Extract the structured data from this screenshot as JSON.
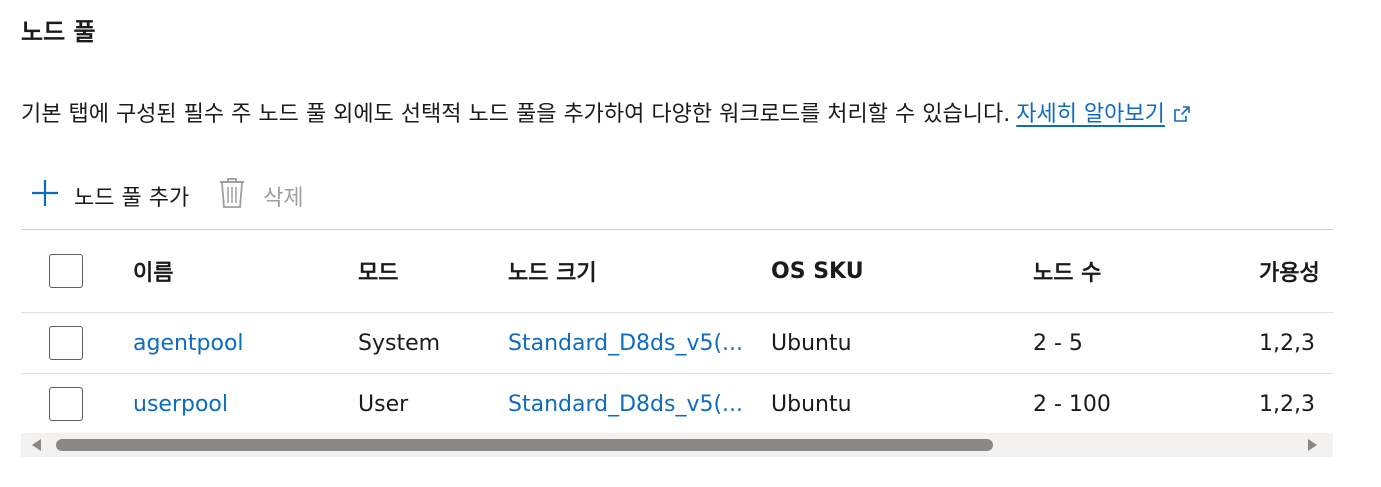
{
  "section": {
    "title": "노드 풀",
    "description": "기본 탭에 구성된 필수 주 노드 풀 외에도 선택적 노드 풀을 추가하여 다양한 워크로드를 처리할 수 있습니다.",
    "learn_more": "자세히 알아보기"
  },
  "toolbar": {
    "add_label": "노드 풀 추가",
    "delete_label": "삭제"
  },
  "table": {
    "columns": [
      "이름",
      "모드",
      "노드 크기",
      "OS SKU",
      "노드 수",
      "가용성"
    ],
    "rows": [
      {
        "name": "agentpool",
        "mode": "System",
        "size": "Standard_D8ds_v5(...",
        "os": "Ubuntu",
        "count": "2 - 5",
        "availability": "1,2,3"
      },
      {
        "name": "userpool",
        "mode": "User",
        "size": "Standard_D8ds_v5(...",
        "os": "Ubuntu",
        "count": "2 - 100",
        "availability": "1,2,3"
      }
    ]
  },
  "colors": {
    "accent": "#0f6cbd",
    "disabled": "#a19f9d"
  },
  "icons": [
    "add-icon",
    "delete-icon",
    "external-link-icon"
  ]
}
